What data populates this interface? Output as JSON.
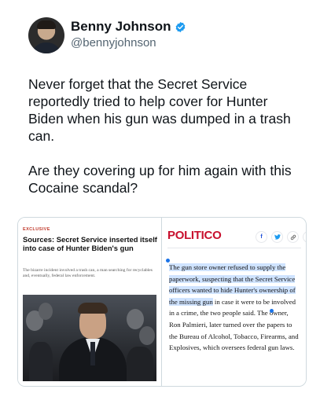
{
  "tweet": {
    "display_name": "Benny Johnson",
    "handle": "@bennyjohnson",
    "paragraphs": [
      "Never forget that the Secret Service reportedly tried to help cover for Hunter Biden when his gun was dumped in a trash can.",
      "Are they covering up for him again with this Cocaine scandal?"
    ]
  },
  "left_card": {
    "label": "EXCLUSIVE",
    "headline": "Sources: Secret Service inserted itself into case of Hunter Biden's gun",
    "dek": "The bizarre incident involved a trash can, a man searching for recyclables and, eventually, federal law enforcement."
  },
  "right_card": {
    "logo": "POLITICO",
    "share_icons": [
      "facebook-icon",
      "twitter-icon",
      "link-icon",
      "more-icon"
    ],
    "article_highlighted": "The gun store owner refused to supply the paperwork, suspecting that the Secret Service officers wanted to hide Hunter's ownership of the missing gun",
    "article_rest": " in case it were to be involved in a crime, the two people said. The owner, Ron Palmieri, later turned over the papers to the Bureau of Alcohol, Tobacco, Firearms, and Explosives, which oversees federal gun laws."
  },
  "colors": {
    "politico_red": "#c8102e",
    "verified_blue": "#1d9bf0",
    "highlight": "#cfe3ff"
  }
}
